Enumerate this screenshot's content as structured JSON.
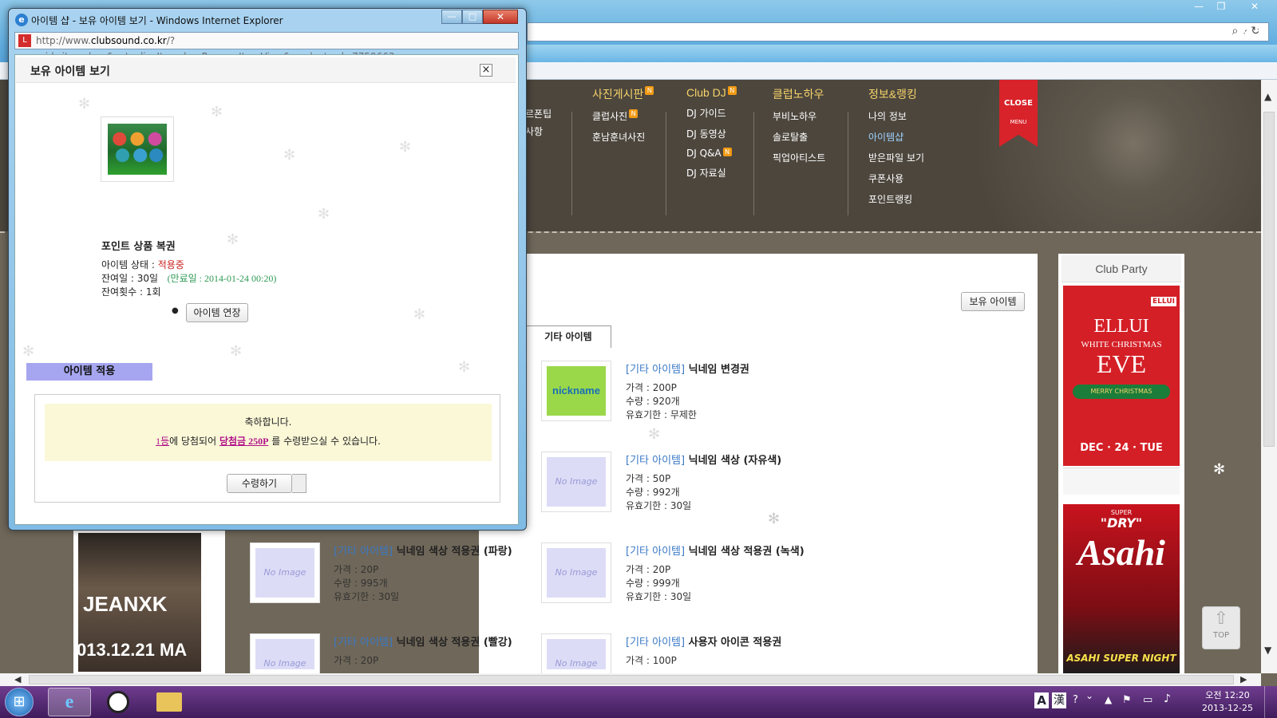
{
  "popup_window": {
    "title": "아이템 샵 - 보유 아이템 보기 - Windows Internet Explorer",
    "url_prefix": "http://www.",
    "url_domain": "clubsound.co.kr",
    "url_rest": "/?mid=itemshop&act=dispItemshopPossessItemView&product_srl=7759663"
  },
  "dialog": {
    "title": "보유 아이템 보기",
    "close_label": "×",
    "item_name": "포인트 상품 복권",
    "status_label": "아이템 상태 : ",
    "status_value": "적용중",
    "remaining_days_label": "잔여일 : 30일",
    "expiry_label": "(만료일 : 2014-01-24 00:20)",
    "remaining_count_label": "잔여횟수 : 1회",
    "extend_button": "아이템 연장",
    "apply_section": "아이템 적용",
    "congrats": "축하합니다.",
    "prize_rank": "1등",
    "prize_mid": "에 당첨되어 ",
    "prize_amount": "당첨금 250P",
    "prize_end": " 를 수령받으실 수 있습니다.",
    "receive_button": "수령하기"
  },
  "site_nav": [
    {
      "head": "사진게시판",
      "items": [
        "클럽사진",
        "훈남훈녀사진"
      ],
      "badge_head": true,
      "badge_items": [
        true,
        false
      ]
    },
    {
      "head": "Club DJ",
      "items": [
        "DJ 가이드",
        "DJ 동영상",
        "DJ Q&A",
        "DJ 자료실"
      ],
      "badge_head": true,
      "badge_items": [
        false,
        false,
        true,
        false
      ]
    },
    {
      "head": "클럽노하우",
      "items": [
        "부비노하우",
        "솔로탈출",
        "픽업아티스트"
      ],
      "badge_head": false,
      "badge_items": [
        false,
        false,
        false
      ]
    },
    {
      "head": "정보&랭킹",
      "items": [
        "나의 정보",
        "아이템샵",
        "받은파일 보기",
        "쿠폰사용",
        "포인트랭킹"
      ],
      "badge_head": false,
      "badge_items": [
        false,
        false,
        false,
        false,
        false
      ]
    }
  ],
  "badge_char": "N",
  "partial_nav": [
    "르폰팁",
    "사항"
  ],
  "close_flag": {
    "label": "CLOSE",
    "menu": "MENU"
  },
  "shop": {
    "owned_button": "보유 아이템",
    "tab_label": "기타 아이템",
    "items": [
      {
        "category": "[기타 아이템]",
        "name": "닉네임 변경권",
        "price": "가격 : 200P",
        "qty": "수량 : 920개",
        "validity": "유효기한 : 무제한",
        "thumb": "nickname"
      },
      {
        "category": "[기타 아이템]",
        "name": "닉네임 색상 (자유색)",
        "price": "가격 : 50P",
        "qty": "수량 : 992개",
        "validity": "유효기한 : 30일",
        "thumb": "noimage"
      },
      {
        "category": "[기타 아이템]",
        "name": "닉네임 색상 적용권 (파랑)",
        "price": "가격 : 20P",
        "qty": "수량 : 995개",
        "validity": "유효기한 : 30일",
        "thumb": "noimage"
      },
      {
        "category": "[기타 아이템]",
        "name": "닉네임 색상 적용권 (녹색)",
        "price": "가격 : 20P",
        "qty": "수량 : 999개",
        "validity": "유효기한 : 30일",
        "thumb": "noimage"
      },
      {
        "category": "[기타 아이템]",
        "name": "닉네임 색상 적용권 (빨강)",
        "price": "가격 : 20P",
        "qty": "",
        "validity": "",
        "thumb": "noimage"
      },
      {
        "category": "[기타 아이템]",
        "name": "사용자 아이콘 적용권",
        "price": "가격 : 100P",
        "qty": "",
        "validity": "",
        "thumb": "noimage"
      }
    ],
    "noimage_text": "No Image",
    "nickname_text": "nickname"
  },
  "sidebar": {
    "club_party": "Club Party",
    "ellui_brand": "ELLUI",
    "ellui_line1": "WHITE CHRISTMAS",
    "ellui_line2": "EVE",
    "ellui_ribbon": "MERRY CHRISTMAS",
    "ellui_date": "DEC · 24 · TUE",
    "asahi_super": "SUPER",
    "asahi_dry": "\"DRY\"",
    "asahi_brand": "Asahi",
    "asahi_bottom": "ASAHI SUPER NIGHT",
    "top_button": "TOP"
  },
  "left_banner": {
    "text1": "JEANXK",
    "text2": "013.12.21 MA"
  },
  "taskbar": {
    "ime_a": "A",
    "ime_han": "漢",
    "time": "오전 12:20",
    "date": "2013-12-25"
  }
}
